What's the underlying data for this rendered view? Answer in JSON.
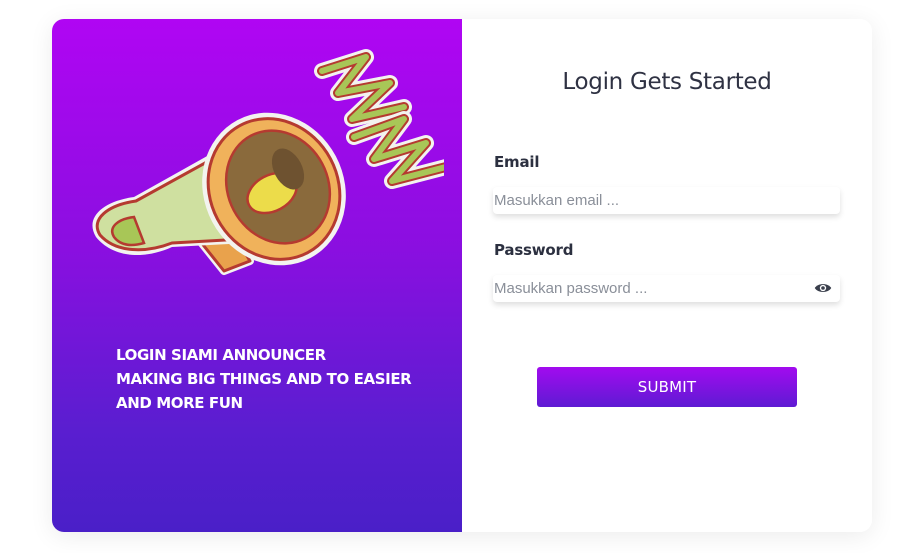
{
  "branding": {
    "tagline_lines": [
      "LOGIN SIAMI ANNOUNCER",
      "MAKING BIG THINGS AND TO EASIER",
      "AND MORE FUN"
    ],
    "illustration_icon": "megaphone-icon"
  },
  "form": {
    "title": "Login Gets Started",
    "email": {
      "label": "Email",
      "value": "",
      "placeholder": "Masukkan email ..."
    },
    "password": {
      "label": "Password",
      "value": "",
      "placeholder": "Masukkan password ...",
      "toggle_icon": "eye-icon"
    },
    "submit_label": "SUBMIT"
  },
  "colors": {
    "panel_gradient_top": "#b005f3",
    "panel_gradient_bottom": "#4a1fc8",
    "button_gradient_top": "#a20bef",
    "button_gradient_bottom": "#5e1bd3",
    "title_text": "#2f3243"
  }
}
